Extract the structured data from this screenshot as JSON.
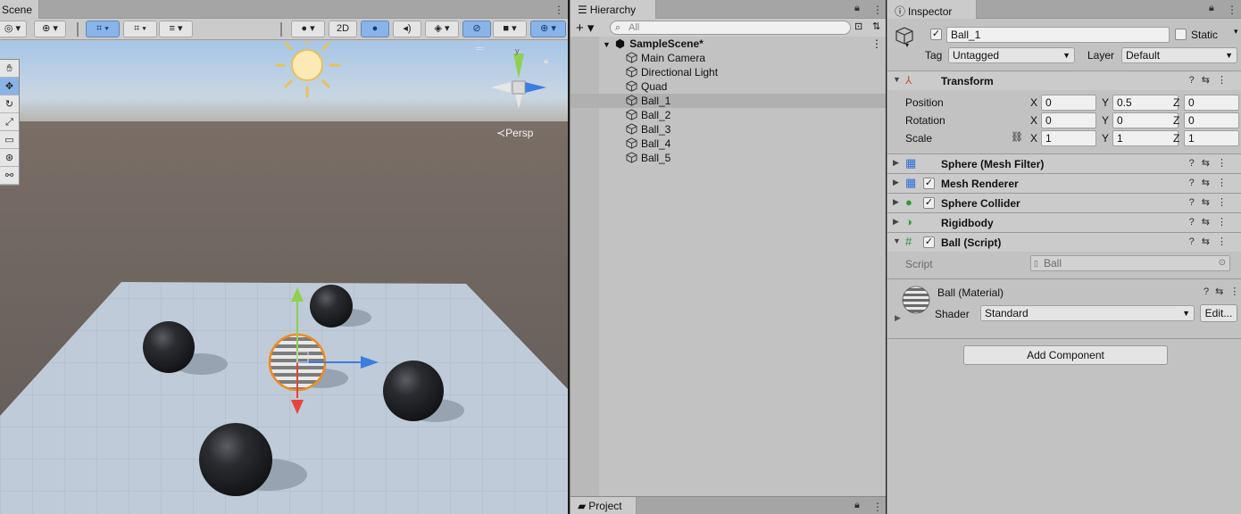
{
  "scene": {
    "tab_label": "Scene",
    "toolbar": {
      "mode_2d": "2D"
    },
    "persp_label": "Persp",
    "tools": [
      "hand",
      "move",
      "rotate",
      "scale",
      "rect",
      "transform",
      "custom"
    ]
  },
  "hierarchy": {
    "tab_label": "Hierarchy",
    "add_label": "+",
    "search_placeholder": "All",
    "scene_name": "SampleScene*",
    "items": [
      {
        "label": "Main Camera"
      },
      {
        "label": "Directional Light"
      },
      {
        "label": "Quad"
      },
      {
        "label": "Ball_1",
        "selected": true
      },
      {
        "label": "Ball_2"
      },
      {
        "label": "Ball_3"
      },
      {
        "label": "Ball_4"
      },
      {
        "label": "Ball_5"
      }
    ],
    "project_tab_label": "Project"
  },
  "inspector": {
    "tab_label": "Inspector",
    "object_name": "Ball_1",
    "static_label": "Static",
    "tag_label": "Tag",
    "tag_value": "Untagged",
    "layer_label": "Layer",
    "layer_value": "Default",
    "transform": {
      "title": "Transform",
      "position_label": "Position",
      "rotation_label": "Rotation",
      "scale_label": "Scale",
      "axis_x": "X",
      "axis_y": "Y",
      "axis_z": "Z",
      "position": [
        "0",
        "0.5",
        "0"
      ],
      "rotation": [
        "0",
        "0",
        "0"
      ],
      "scale": [
        "1",
        "1",
        "1"
      ]
    },
    "components": [
      {
        "title": "Sphere (Mesh Filter)",
        "has_check": false
      },
      {
        "title": "Mesh Renderer",
        "has_check": true
      },
      {
        "title": "Sphere Collider",
        "has_check": true
      },
      {
        "title": "Rigidbody",
        "has_check": false
      },
      {
        "title": "Ball (Script)",
        "has_check": true
      }
    ],
    "script_label": "Script",
    "script_value": "Ball",
    "material_name": "Ball (Material)",
    "shader_label": "Shader",
    "shader_value": "Standard",
    "edit_label": "Edit...",
    "add_component_label": "Add Component"
  },
  "colors": {
    "selection_blue": "#8ab4e8",
    "gizmo_x": "#e8423a",
    "gizmo_y": "#8fd14f",
    "gizmo_z": "#3c7de0",
    "selection_outline": "#f08a1f"
  }
}
